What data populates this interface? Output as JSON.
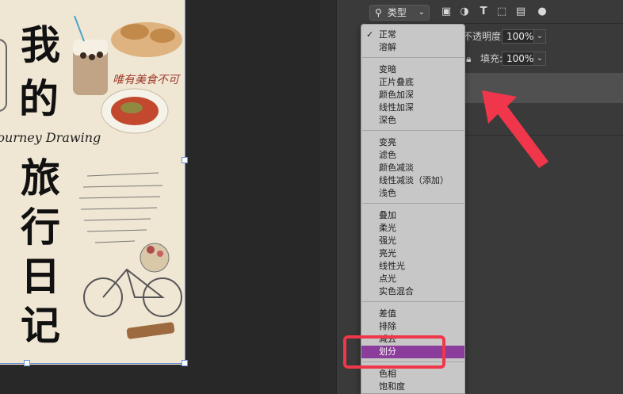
{
  "canvas": {
    "title_chars": [
      "我",
      "的",
      "旅",
      "行",
      "日",
      "记"
    ],
    "script_text": "Journey Drawing",
    "red_text": "唯有美食不可"
  },
  "filter_bar": {
    "filter_label": "类型",
    "icons": [
      "image-filter-icon",
      "adjustment-filter-icon",
      "text-filter-icon",
      "shape-filter-icon",
      "smart-object-filter-icon",
      "toggle-filter-icon"
    ]
  },
  "properties": {
    "opacity_label": "不透明度:",
    "opacity_value": "100%",
    "fill_label": "填充:",
    "fill_value": "100%"
  },
  "blend_menu": {
    "groups": [
      [
        "正常",
        "溶解"
      ],
      [
        "变暗",
        "正片叠底",
        "颜色加深",
        "线性加深",
        "深色"
      ],
      [
        "变亮",
        "滤色",
        "颜色减淡",
        "线性减淡（添加）",
        "浅色"
      ],
      [
        "叠加",
        "柔光",
        "强光",
        "亮光",
        "线性光",
        "点光",
        "实色混合"
      ],
      [
        "差值",
        "排除",
        "减去",
        "划分"
      ],
      [
        "色相",
        "饱和度"
      ]
    ],
    "checked": "正常",
    "selected": "划分"
  },
  "colors": {
    "selection": "#8a3d9a",
    "annotation": "#f0364a",
    "guide": "#6a90d8"
  }
}
